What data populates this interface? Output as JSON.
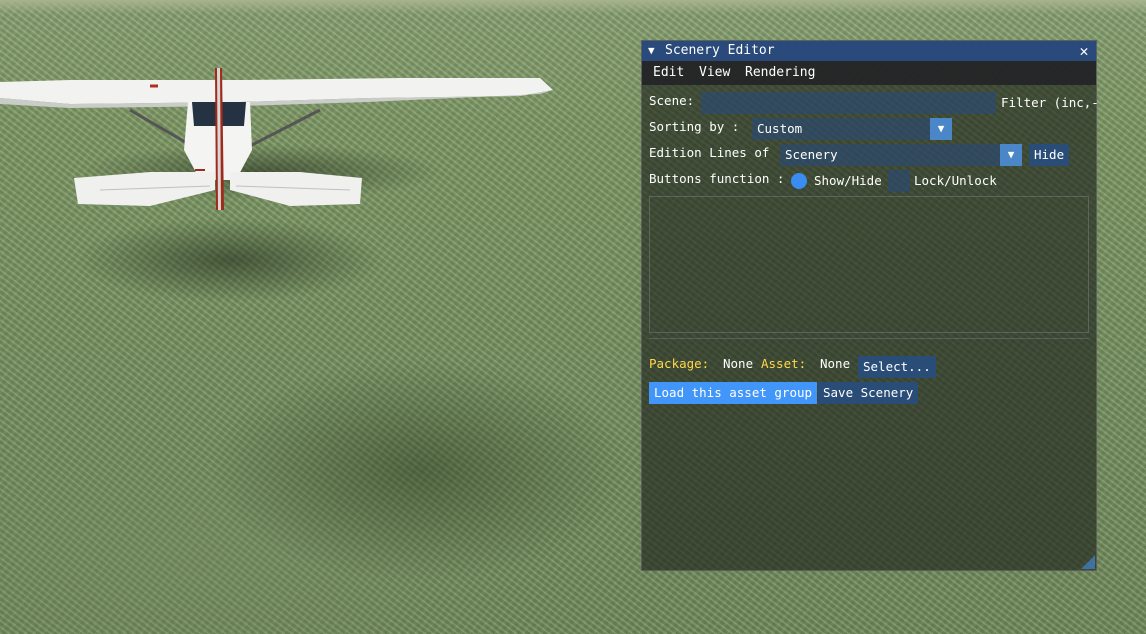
{
  "window": {
    "title": "Scenery Editor",
    "close_glyph": "✕",
    "collapse_glyph": "▼"
  },
  "menu": {
    "items": [
      "Edit",
      "View",
      "Rendering"
    ]
  },
  "scene": {
    "label": "Scene:",
    "value": "",
    "filter_label": "Filter (inc,-"
  },
  "sorting": {
    "label": "Sorting by :",
    "value": "Custom",
    "arrow": "▼"
  },
  "edition": {
    "label": "Edition Lines of",
    "value": "Scenery",
    "arrow": "▼",
    "hide_button": "Hide"
  },
  "buttons_function": {
    "label": "Buttons function :",
    "option1": "Show/Hide",
    "option1_selected": true,
    "option2": "Lock/Unlock",
    "option2_selected": false
  },
  "package": {
    "package_label": "Package:",
    "package_value": "None",
    "asset_label": "Asset:",
    "asset_value": "None",
    "select_button": "Select..."
  },
  "actions": {
    "load_button": "Load this asset group",
    "save_button": "Save Scenery"
  },
  "colors": {
    "title_bar": "#294a7a",
    "accent": "#4296fa",
    "label_yellow": "#ffd84a"
  }
}
